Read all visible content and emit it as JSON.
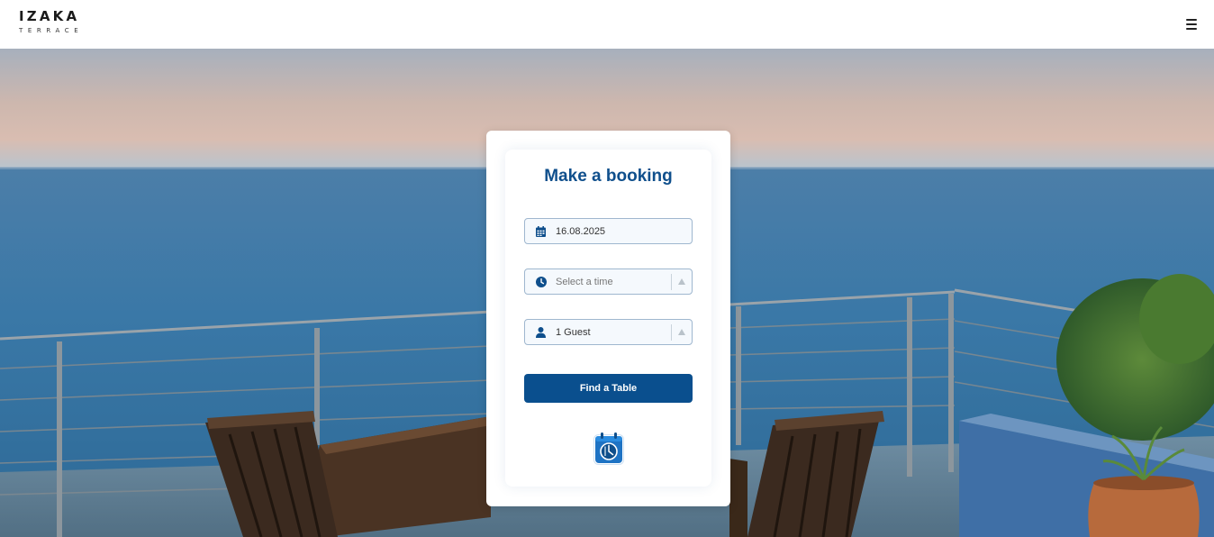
{
  "brand": {
    "name": "IZAKA",
    "tagline": "TERRACE"
  },
  "nav": {
    "menu_icon": "hamburger-icon"
  },
  "booking": {
    "title": "Make a booking",
    "date": {
      "value": "16.08.2025",
      "icon": "calendar-icon"
    },
    "time": {
      "placeholder": "Select a time",
      "icon": "clock-icon"
    },
    "guests": {
      "value": "1 Guest",
      "icon": "user-icon"
    },
    "submit_label": "Find a Table",
    "badge_icon": "calendar-clock-logo"
  },
  "colors": {
    "accent": "#0a4f8e",
    "title": "#0f4f8c"
  }
}
